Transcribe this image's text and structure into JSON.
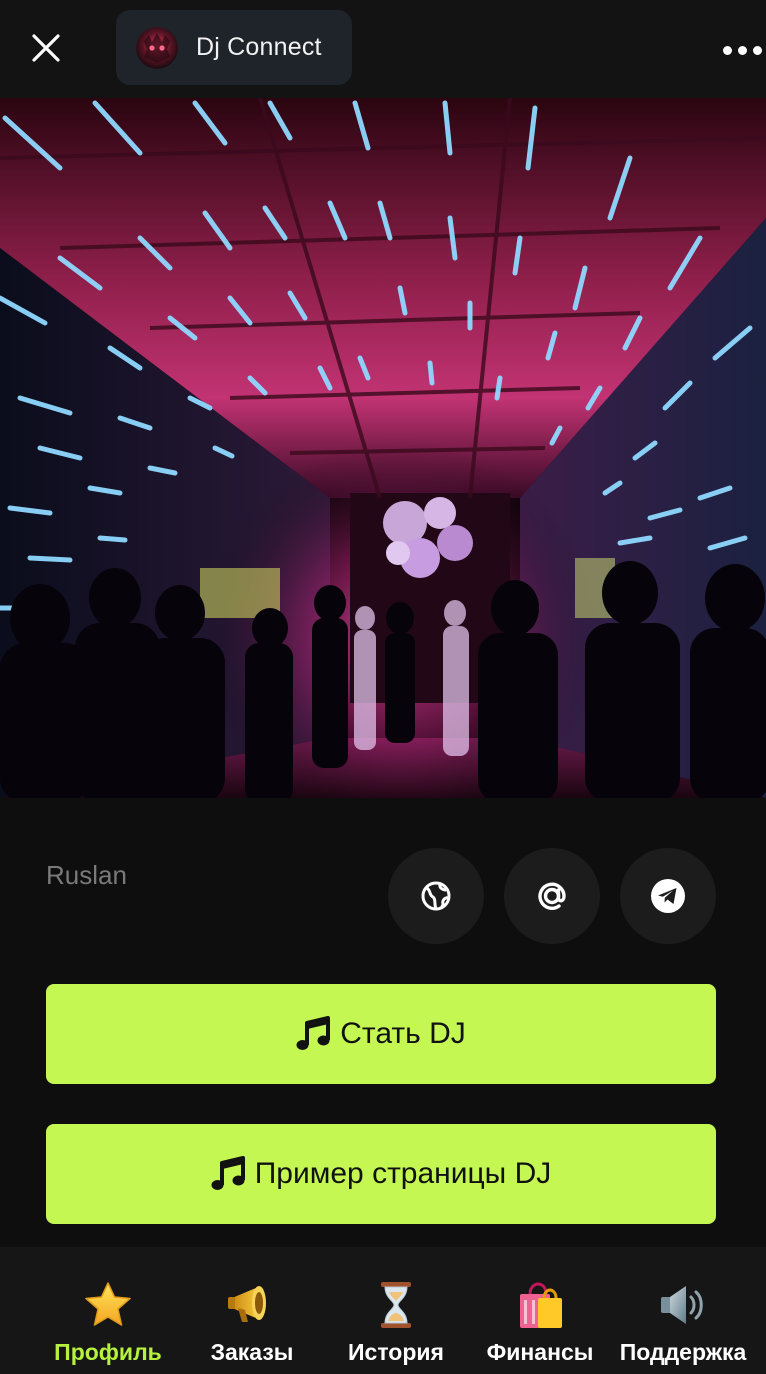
{
  "header": {
    "app_title": "Dj Connect",
    "close_icon": "close-icon",
    "more_icon": "more-horizontal-icon"
  },
  "hero": {
    "icon": "nightclub-photo"
  },
  "profile": {
    "name": "Ruslan",
    "social_links": [
      {
        "icon": "globe-icon"
      },
      {
        "icon": "at-sign-icon"
      },
      {
        "icon": "telegram-icon"
      }
    ]
  },
  "actions": {
    "become_dj_label": "Стать DJ",
    "example_page_label": "Пример страницы DJ",
    "button_icon": "music-note-icon"
  },
  "tabbar": {
    "items": [
      {
        "label": "Профиль",
        "icon": "star-icon",
        "active": true
      },
      {
        "label": "Заказы",
        "icon": "megaphone-icon",
        "active": false
      },
      {
        "label": "История",
        "icon": "hourglass-icon",
        "active": false
      },
      {
        "label": "Финансы",
        "icon": "shopping-bags-icon",
        "active": false
      },
      {
        "label": "Поддержка",
        "icon": "speaker-icon",
        "active": false
      }
    ]
  },
  "colors": {
    "accent": "#c4f752",
    "active_tab": "#b6f23d",
    "background": "#0e0e0e"
  }
}
